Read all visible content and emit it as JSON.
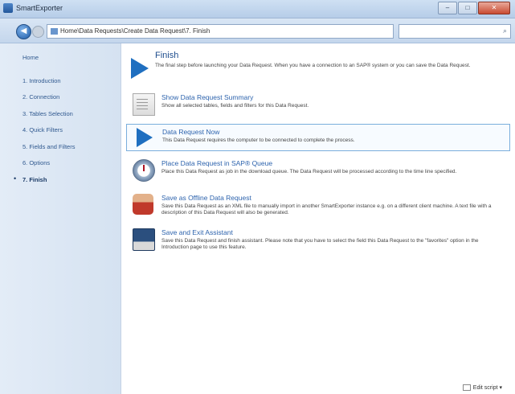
{
  "window": {
    "title": "SmartExporter"
  },
  "nav": {
    "address": "Home\\Data Requests\\Create Data Request\\7. Finish",
    "search_placeholder": ""
  },
  "sidebar": {
    "home": "Home",
    "items": [
      {
        "label": "1. Introduction"
      },
      {
        "label": "2. Connection"
      },
      {
        "label": "3. Tables Selection"
      },
      {
        "label": "4. Quick Filters"
      },
      {
        "label": "5. Fields and Filters"
      },
      {
        "label": "6. Options"
      },
      {
        "label": "7. Finish"
      }
    ]
  },
  "main": {
    "title": "Finish",
    "description": "The final step before launching your Data Request. When you have a connection to an SAP® system or you can save the Data Request.",
    "options": [
      {
        "title": "Show Data Request Summary",
        "desc": "Show all selected tables, fields and filters for this Data Request.",
        "icon": "document-icon"
      },
      {
        "title": "Data Request Now",
        "desc": "This Data Request requires the computer to be connected to complete the process.",
        "icon": "play-icon"
      },
      {
        "title": "Place Data Request in SAP® Queue",
        "desc": "Place this Data Request as job in the download queue. The Data Request will be processed according to the time line specified.",
        "icon": "clock-icon"
      },
      {
        "title": "Save as Offline Data Request",
        "desc": "Save this Data Request as an XML file to manually import in another SmartExporter instance e.g. on a different client machine. A text file with a description of this Data Request will also be generated.",
        "icon": "person-icon"
      },
      {
        "title": "Save and Exit Assistant",
        "desc": "Save this Data Request and finish assistant. Please note that you have to select the field this Data Request to the \"favorites\" option in the Introduction page to use this feature.",
        "icon": "disk-icon"
      }
    ]
  },
  "footer": {
    "label": "Edit script"
  }
}
